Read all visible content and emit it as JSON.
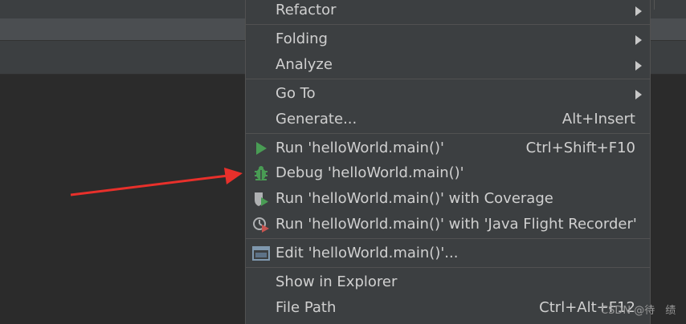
{
  "menu": {
    "items": [
      {
        "label": "Refactor",
        "shortcut": "",
        "submenu": true
      },
      {
        "label": "Folding",
        "shortcut": "",
        "submenu": true
      },
      {
        "label": "Analyze",
        "shortcut": "",
        "submenu": true
      },
      {
        "label": "Go To",
        "shortcut": "",
        "submenu": true
      },
      {
        "label": "Generate...",
        "shortcut": "Alt+Insert",
        "submenu": false
      },
      {
        "label": "Run 'helloWorld.main()'",
        "shortcut": "Ctrl+Shift+F10",
        "icon": "run-icon"
      },
      {
        "label": "Debug 'helloWorld.main()'",
        "shortcut": "",
        "icon": "debug-icon"
      },
      {
        "label": "Run 'helloWorld.main()' with Coverage",
        "shortcut": "",
        "icon": "coverage-icon"
      },
      {
        "label": "Run 'helloWorld.main()' with 'Java Flight Recorder'",
        "shortcut": "",
        "icon": "profiler-icon"
      },
      {
        "label": "Edit 'helloWorld.main()'...",
        "shortcut": "",
        "icon": "edit-config-icon"
      },
      {
        "label": "Show in Explorer",
        "shortcut": ""
      },
      {
        "label": "File Path",
        "shortcut": "Ctrl+Alt+F12"
      }
    ]
  },
  "watermark": "CSDN @待　绩",
  "colors": {
    "menu_bg": "#3c3f41",
    "editor_bg": "#2b2b2b",
    "text": "#d0d0d0",
    "run_green": "#499c54",
    "annotation_red": "#e8302b"
  }
}
